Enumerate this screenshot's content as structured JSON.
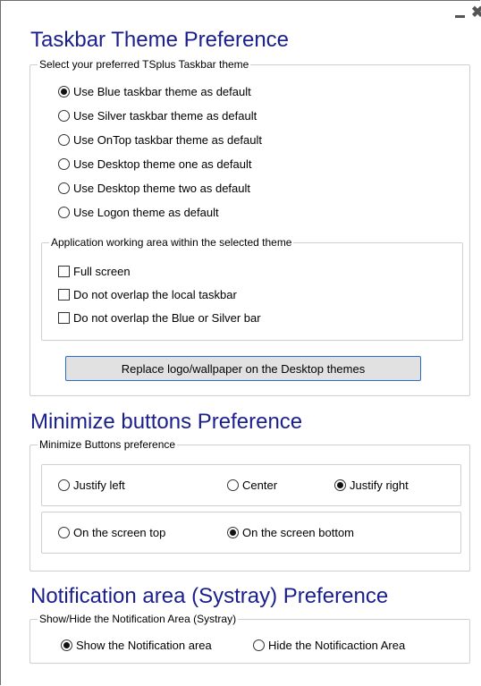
{
  "window": {
    "minimize_glyph": "",
    "close_glyph": "✖"
  },
  "taskbar": {
    "title": "Taskbar Theme Preference",
    "group_label": "Select your preferred TSplus Taskbar theme",
    "themes": [
      {
        "label": "Use Blue taskbar theme as default",
        "selected": true
      },
      {
        "label": "Use Silver taskbar theme as default",
        "selected": false
      },
      {
        "label": "Use OnTop taskbar theme as default",
        "selected": false
      },
      {
        "label": "Use Desktop theme one as default",
        "selected": false
      },
      {
        "label": "Use Desktop theme two as default",
        "selected": false
      },
      {
        "label": "Use Logon theme as default",
        "selected": false
      }
    ],
    "working_area": {
      "group_label": "Application working area within the selected theme",
      "options": [
        {
          "label": "Full screen",
          "checked": false
        },
        {
          "label": "Do not overlap the local taskbar",
          "checked": false
        },
        {
          "label": "Do not overlap the Blue or Silver bar",
          "checked": false
        }
      ]
    },
    "replace_button_label": "Replace logo/wallpaper on the Desktop themes"
  },
  "minimize": {
    "title": "Minimize buttons Preference",
    "group_label": "Minimize Buttons preference",
    "justify": [
      {
        "label": "Justify left",
        "selected": false
      },
      {
        "label": "Center",
        "selected": false
      },
      {
        "label": "Justify right",
        "selected": true
      }
    ],
    "position": [
      {
        "label": "On the screen top",
        "selected": false
      },
      {
        "label": "On the screen bottom",
        "selected": true
      }
    ]
  },
  "notification": {
    "title": "Notification area (Systray) Preference",
    "group_label": "Show/Hide the Notification Area (Systray)",
    "options": [
      {
        "label": "Show the Notification area",
        "selected": true
      },
      {
        "label": "Hide the Notificaction Area",
        "selected": false
      }
    ]
  },
  "colors": {
    "heading": "#1a1f8c",
    "button_border": "#2b6cc6",
    "button_bg": "#e1e1e1"
  }
}
